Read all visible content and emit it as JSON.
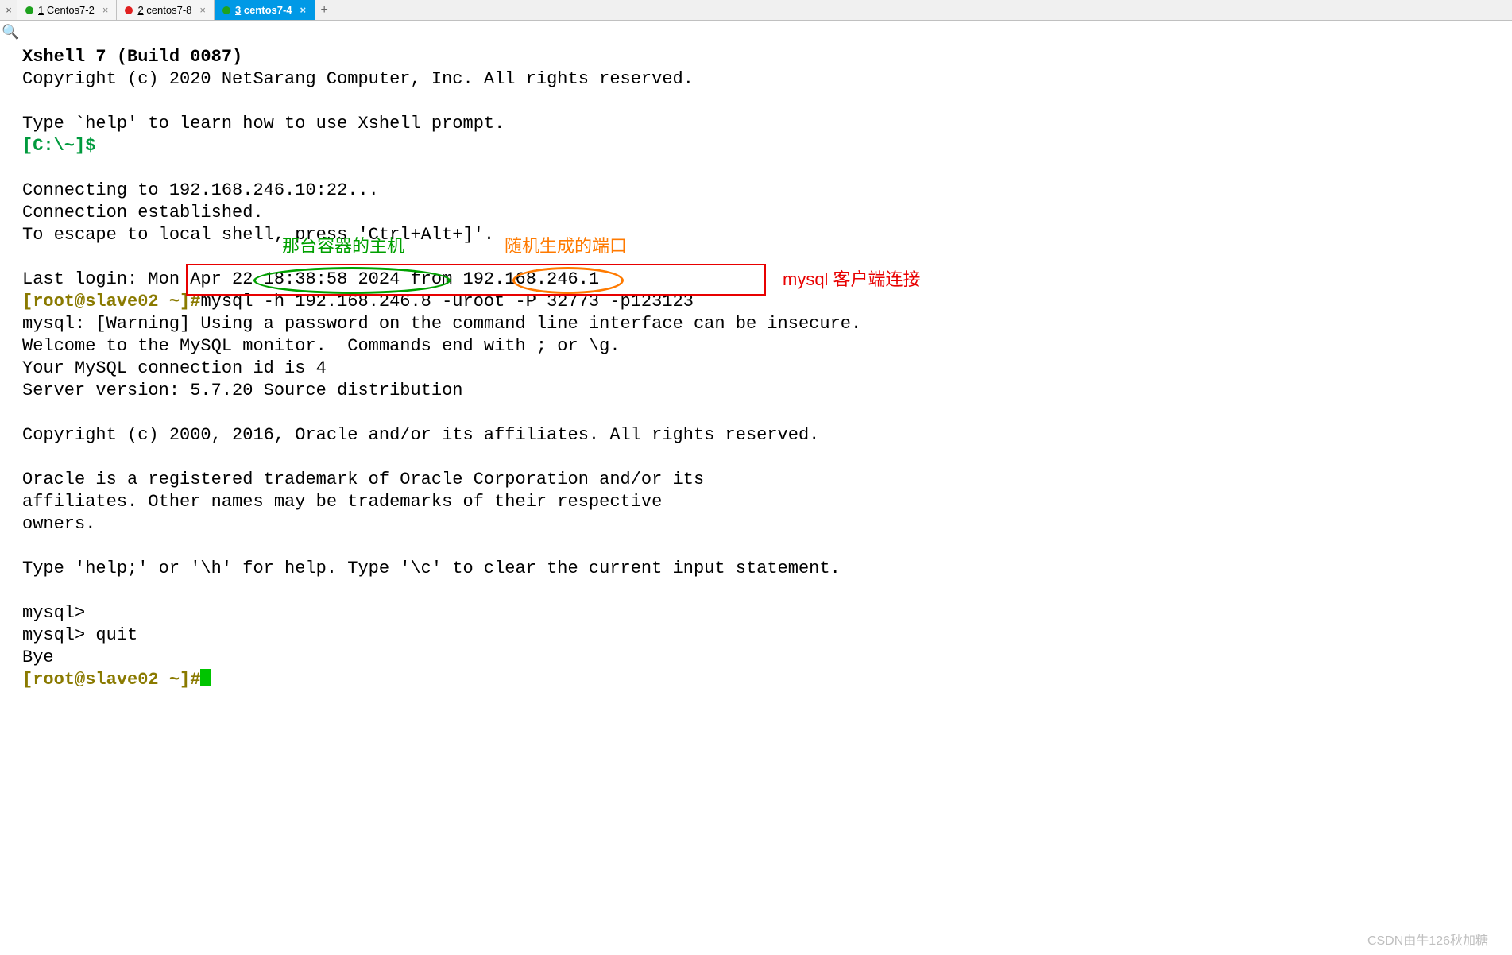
{
  "tabs": {
    "items": [
      {
        "num": "1",
        "label": "Centos7-2",
        "dot": "green",
        "active": false
      },
      {
        "num": "2",
        "label": "centos7-8",
        "dot": "red",
        "active": false
      },
      {
        "num": "3",
        "label": "centos7-4",
        "dot": "green",
        "active": true
      }
    ],
    "close_left": "×",
    "close_glyph": "×",
    "add_glyph": "+"
  },
  "term": {
    "line1": "Xshell 7 (Build 0087)",
    "line2": "Copyright (c) 2020 NetSarang Computer, Inc. All rights reserved.",
    "line3": "",
    "line4": "Type `help' to learn how to use Xshell prompt.",
    "prompt1": "[C:\\~]$",
    "line6": "",
    "line7": "Connecting to 192.168.246.10:22...",
    "line8": "Connection established.",
    "line9": "To escape to local shell, press 'Ctrl+Alt+]'.",
    "line10": "",
    "line11": "Last login: Mon Apr 22 18:38:58 2024 from 192.168.246.1",
    "prompt2": "[root@slave02 ~]#",
    "cmd": "mysql -h 192.168.246.8 -uroot -P 32773 -p123123",
    "line13": "mysql: [Warning] Using a password on the command line interface can be insecure.",
    "line14": "Welcome to the MySQL monitor.  Commands end with ; or \\g.",
    "line15": "Your MySQL connection id is 4",
    "line16": "Server version: 5.7.20 Source distribution",
    "line17": "",
    "line18": "Copyright (c) 2000, 2016, Oracle and/or its affiliates. All rights reserved.",
    "line19": "",
    "line20": "Oracle is a registered trademark of Oracle Corporation and/or its",
    "line21": "affiliates. Other names may be trademarks of their respective",
    "line22": "owners.",
    "line23": "",
    "line24": "Type 'help;' or '\\h' for help. Type '\\c' to clear the current input statement.",
    "line25": "",
    "line26": "mysql>",
    "line27": "mysql> quit",
    "line28": "Bye",
    "prompt3": "[root@slave02 ~]#"
  },
  "annotations": {
    "host_label": "那台容器的主机",
    "port_label": "随机生成的端口",
    "mysql_label": "mysql 客户端连接"
  },
  "watermark": "CSDN由牛126秋加糖"
}
